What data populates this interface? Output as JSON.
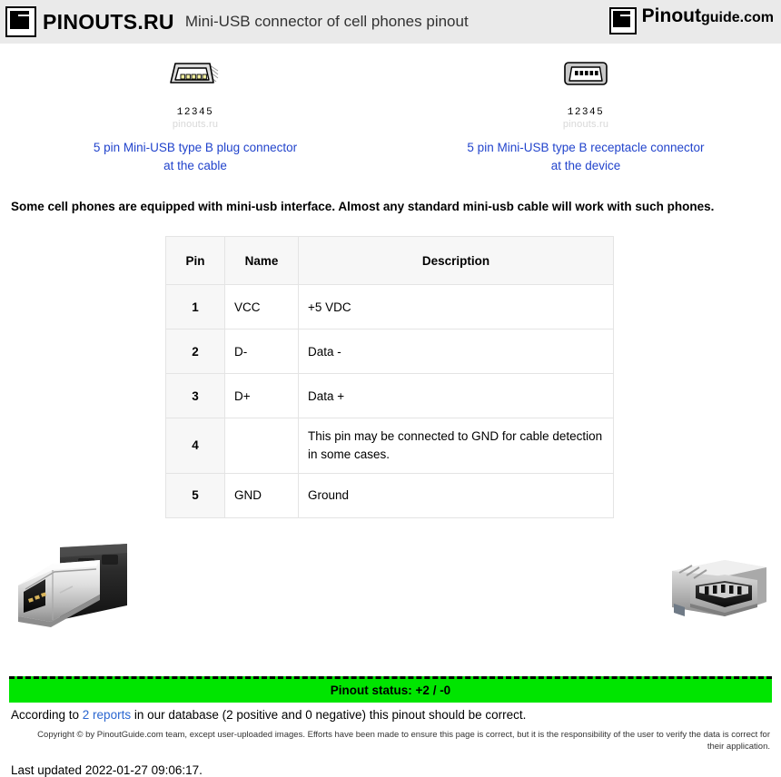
{
  "header": {
    "brand_left": "PINOUTS.RU",
    "page_title": "Mini-USB connector of cell phones pinout",
    "brand_right_primary": "Pinout",
    "brand_right_secondary": "guide.com",
    "logo_icon": "pinout-logo-icon"
  },
  "diagrams": [
    {
      "art": "mini-usb-type-b-plug-icon",
      "pin_numbers": "12345",
      "watermark": "pinouts.ru",
      "caption_line1": "5 pin Mini-USB type B plug connector",
      "caption_line2": "at the cable"
    },
    {
      "art": "mini-usb-type-b-receptacle-icon",
      "pin_numbers": "12345",
      "watermark": "pinouts.ru",
      "caption_line1": "5 pin Mini-USB type B receptacle connector",
      "caption_line2": "at the device"
    }
  ],
  "intro": "Some cell phones are equipped with mini-usb interface. Almost any standard mini-usb cable will work with such phones.",
  "table": {
    "headers": [
      "Pin",
      "Name",
      "Description"
    ],
    "rows": [
      {
        "pin": "1",
        "name": "VCC",
        "description": "+5 VDC"
      },
      {
        "pin": "2",
        "name": "D-",
        "description": "Data -"
      },
      {
        "pin": "3",
        "name": "D+",
        "description": "Data +"
      },
      {
        "pin": "4",
        "name": "",
        "description": "This pin may be connected to GND for cable detection in some cases."
      },
      {
        "pin": "5",
        "name": "GND",
        "description": "Ground"
      }
    ]
  },
  "photos": {
    "left": "mini-usb-plug-photo",
    "right": "mini-usb-receptacle-photo"
  },
  "status": {
    "bar_label": "Pinout status: +2 / -0",
    "note_prefix": "According to ",
    "note_link": "2 reports",
    "note_suffix": " in our database (2 positive and 0 negative) this pinout should be correct.",
    "bar_color": "#00e500"
  },
  "footer": {
    "copyright": "Copyright © by PinoutGuide.com team, except user-uploaded images. Efforts have been made to ensure this page is correct, but it is the responsibility of the user to verify the data is correct for their application.",
    "last_updated": "Last updated 2022-01-27 09:06:17."
  }
}
